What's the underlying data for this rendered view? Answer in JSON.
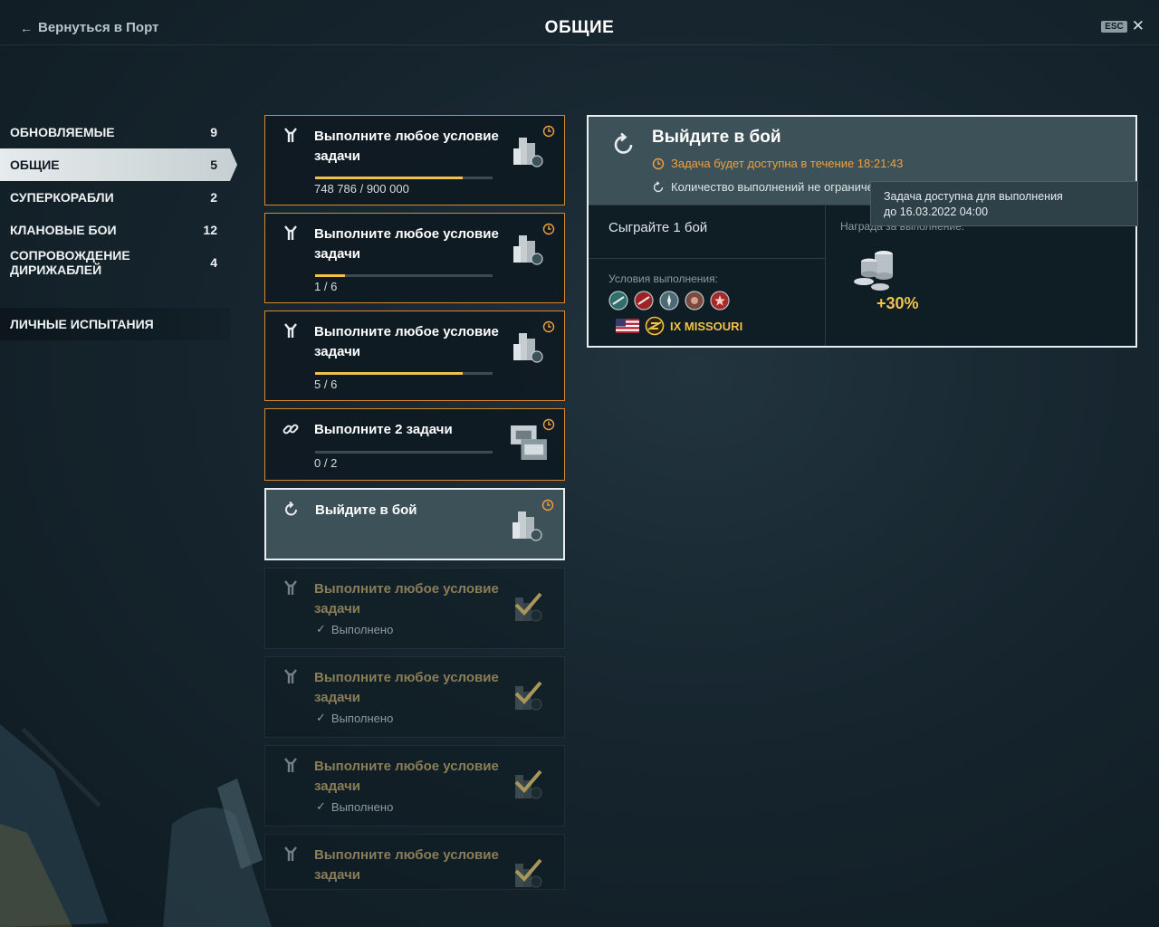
{
  "header": {
    "back_label": "Вернуться в Порт",
    "title": "ОБЩИЕ",
    "esc_label": "ESC"
  },
  "sidebar": {
    "categories": [
      {
        "label": "ОБНОВЛЯЕМЫЕ",
        "count": "9"
      },
      {
        "label": "ОБЩИЕ",
        "count": "5",
        "active": true
      },
      {
        "label": "СУПЕРКОРАБЛИ",
        "count": "2"
      },
      {
        "label": "КЛАНОВЫЕ БОИ",
        "count": "12"
      },
      {
        "label": "СОПРОВОЖДЕНИЕ ДИРИЖАБЛЕЙ",
        "count": "4"
      }
    ],
    "personal_label": "ЛИЧНЫЕ ИСПЫТАНИЯ"
  },
  "tasks": [
    {
      "title": "Выполните любое условие задачи",
      "progress_text": "748 786 / 900 000",
      "progress": 0.832,
      "icon": "branch-icon",
      "reward": "credits-icon"
    },
    {
      "title": "Выполните любое условие задачи",
      "progress_text": "1 / 6",
      "progress": 0.167,
      "icon": "branch-icon",
      "reward": "credits-icon"
    },
    {
      "title": "Выполните любое условие задачи",
      "progress_text": "5 / 6",
      "progress": 0.833,
      "icon": "branch-icon",
      "reward": "credits-icon"
    },
    {
      "title": "Выполните 2 задачи",
      "progress_text": "0 / 2",
      "progress": 0.0,
      "icon": "link-icon",
      "reward": "container-icon"
    },
    {
      "title": "Выйдите в бой",
      "icon": "refresh-icon",
      "reward": "credits-icon",
      "selected": true
    },
    {
      "title": "Выполните любое условие задачи",
      "status": "Выполнено",
      "icon": "branch-icon",
      "completed": true
    },
    {
      "title": "Выполните любое условие задачи",
      "status": "Выполнено",
      "icon": "branch-icon",
      "completed": true
    },
    {
      "title": "Выполните любое условие задачи",
      "status": "Выполнено",
      "icon": "branch-icon",
      "completed": true
    },
    {
      "title": "Выполните любое условие задачи",
      "icon": "branch-icon",
      "completed": true
    }
  ],
  "detail": {
    "title": "Выйдите в бой",
    "timer_text": "Задача будет доступна в течение 18:21:43",
    "limit_text": "Количество выполнений не ограниче",
    "task_text": "Сыграйте 1 бой",
    "conditions_label": "Условия выполнения:",
    "ship_label": "IX MISSOURI",
    "reward_label": "Награда за выполнение:",
    "reward_bonus": "+30%"
  },
  "tooltip": {
    "line1": "Задача доступна для выполнения",
    "line2": "до 16.03.2022 04:00"
  },
  "colors": {
    "accent_orange": "#d68a2e",
    "progress_yellow": "#f2c14a",
    "timer_orange": "#f0a040"
  }
}
